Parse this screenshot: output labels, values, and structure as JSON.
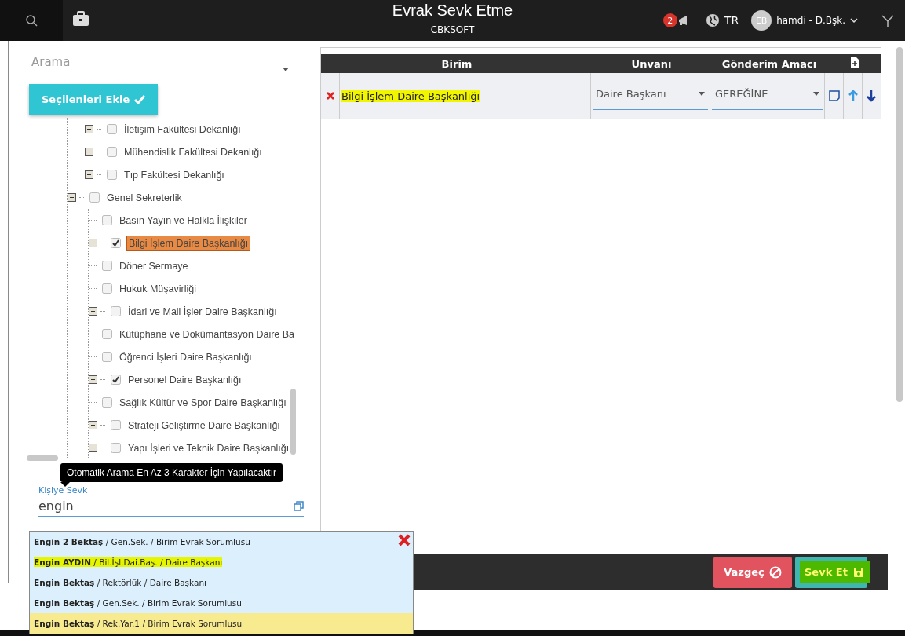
{
  "header": {
    "title": "Evrak Sevk Etme",
    "subtitle": "CBKSOFT",
    "notification_count": "2",
    "language": "TR",
    "avatar": "EB",
    "user": "hamdi - D.Bşk."
  },
  "search": {
    "placeholder": "Arama"
  },
  "add_selected_button": "Seçilenleri Ekle",
  "tree": [
    {
      "label": "İletişim Fakültesi Dekanlığı",
      "checked": false,
      "selected": false,
      "expanded": false
    },
    {
      "label": "Mühendislik Fakültesi Dekanlığı",
      "checked": false,
      "selected": false,
      "expanded": false
    },
    {
      "label": "Tıp Fakültesi Dekanlığı",
      "checked": false,
      "selected": false,
      "expanded": false
    },
    {
      "label": "Genel Sekreterlik",
      "checked": false,
      "selected": false,
      "expanded": true,
      "children": [
        {
          "label": "Basın Yayın ve Halkla İlişkiler",
          "checked": false,
          "selected": false
        },
        {
          "label": "Bilgi İşlem Daire Başkanlığı",
          "checked": true,
          "selected": true,
          "expanded": false
        },
        {
          "label": "Döner Sermaye",
          "checked": false,
          "selected": false
        },
        {
          "label": "Hukuk Müşavirliği",
          "checked": false,
          "selected": false
        },
        {
          "label": "İdari ve Mali İşler Daire Başkanlığı",
          "checked": false,
          "selected": false,
          "expanded": false
        },
        {
          "label": "Kütüphane ve Dokümantasyon Daire Ba",
          "checked": false,
          "selected": false
        },
        {
          "label": "Öğrenci İşleri Daire Başkanlığı",
          "checked": false,
          "selected": false
        },
        {
          "label": "Personel Daire Başkanlığı",
          "checked": true,
          "selected": false,
          "expanded": false
        },
        {
          "label": "Sağlık Kültür ve Spor Daire Başkanlığı",
          "checked": false,
          "selected": false
        },
        {
          "label": "Strateji Geliştirme Daire Başkanlığı",
          "checked": false,
          "selected": false,
          "expanded": false
        },
        {
          "label": "Yapı İşleri ve Teknik Daire Başkanlığı",
          "checked": false,
          "selected": false,
          "expanded": false
        }
      ]
    }
  ],
  "tooltip": "Otomatik Arama En Az 3 Karakter İçin Yapılacaktır",
  "person_field": {
    "label": "Kişiye Sevk",
    "value": "engin"
  },
  "suggestions": [
    {
      "text": "**Engin 2 Bektaş** / Gen.Sek. / Birim Evrak Sorumlusu",
      "selected": false,
      "highlighted": false
    },
    {
      "text": "**Engin AYDIN** / Bil.İşl.Dai.Baş. / Daire Başkanı",
      "selected": false,
      "highlighted": true
    },
    {
      "text": "**Engin Bektaş** / Rektörlük / Daire Başkanı",
      "selected": false,
      "highlighted": false
    },
    {
      "text": "**Engin Bektaş** / Gen.Sek. / Birim Evrak Sorumlusu",
      "selected": false,
      "highlighted": false
    },
    {
      "text": "**Engin Bektaş** / Rek.Yar.1 / Birim Evrak Sorumlusu",
      "selected": true,
      "highlighted": false
    }
  ],
  "table": {
    "columns": [
      "Birim",
      "Unvanı",
      "Gönderim Amacı"
    ],
    "rows": [
      {
        "birim": "Bilgi İşlem Daire Başkanlığı",
        "highlighted": true,
        "unvan": "Daire Başkanı",
        "amac": "GEREĞİNE"
      }
    ]
  },
  "buttons": [
    {
      "label": "Vazgeç",
      "kind": "cancel"
    },
    {
      "label": "Sevk Et",
      "kind": "save",
      "highlighted": true
    }
  ]
}
